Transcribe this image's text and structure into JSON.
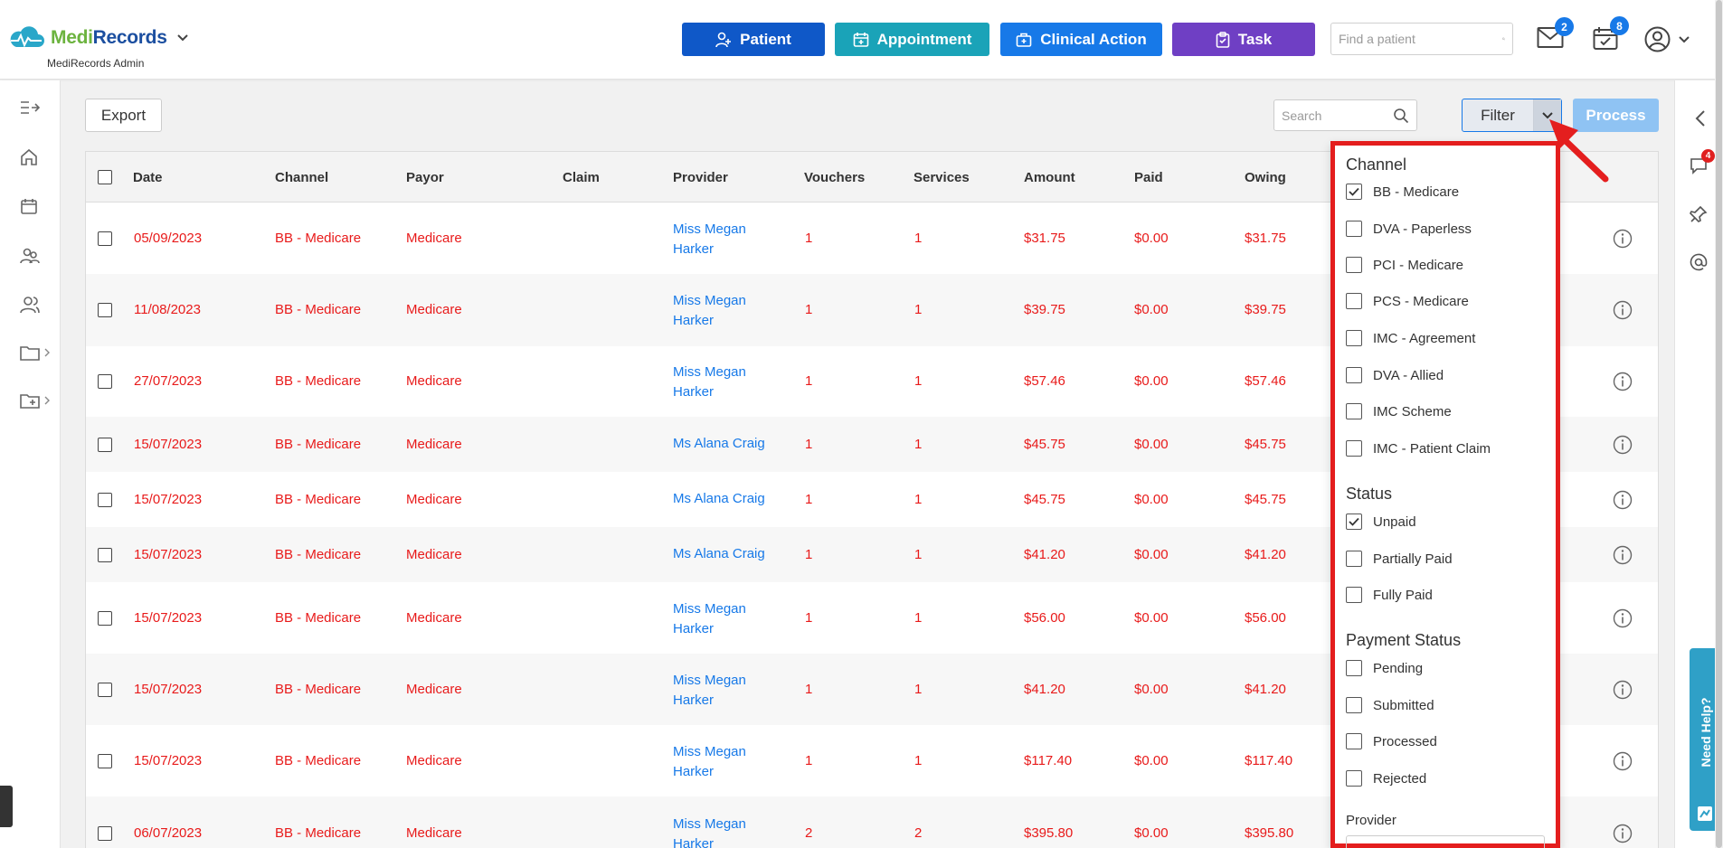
{
  "header": {
    "brand_medi": "Medi",
    "brand_records": "Records",
    "subtitle": "MediRecords Admin",
    "buttons": {
      "patient": "Patient",
      "appointment": "Appointment",
      "clinical_action": "Clinical Action",
      "task": "Task"
    },
    "find_patient_placeholder": "Find a patient",
    "mail_count": "2",
    "tasks_count": "8"
  },
  "toolbar": {
    "export_label": "Export",
    "search_placeholder": "Search",
    "filter_label": "Filter",
    "process_label": "Process"
  },
  "table": {
    "columns": [
      "Date",
      "Channel",
      "Payor",
      "Claim",
      "Provider",
      "Vouchers",
      "Services",
      "Amount",
      "Paid",
      "Owing"
    ],
    "rows": [
      {
        "date": "05/09/2023",
        "channel": "BB - Medicare",
        "payor": "Medicare",
        "claim": "",
        "provider": "Miss Megan Harker",
        "vouchers": "1",
        "services": "1",
        "amount": "$31.75",
        "paid": "$0.00",
        "owing": "$31.75"
      },
      {
        "date": "11/08/2023",
        "channel": "BB - Medicare",
        "payor": "Medicare",
        "claim": "",
        "provider": "Miss Megan Harker",
        "vouchers": "1",
        "services": "1",
        "amount": "$39.75",
        "paid": "$0.00",
        "owing": "$39.75"
      },
      {
        "date": "27/07/2023",
        "channel": "BB - Medicare",
        "payor": "Medicare",
        "claim": "",
        "provider": "Miss Megan Harker",
        "vouchers": "1",
        "services": "1",
        "amount": "$57.46",
        "paid": "$0.00",
        "owing": "$57.46"
      },
      {
        "date": "15/07/2023",
        "channel": "BB - Medicare",
        "payor": "Medicare",
        "claim": "",
        "provider": "Ms Alana Craig",
        "vouchers": "1",
        "services": "1",
        "amount": "$45.75",
        "paid": "$0.00",
        "owing": "$45.75"
      },
      {
        "date": "15/07/2023",
        "channel": "BB - Medicare",
        "payor": "Medicare",
        "claim": "",
        "provider": "Ms Alana Craig",
        "vouchers": "1",
        "services": "1",
        "amount": "$45.75",
        "paid": "$0.00",
        "owing": "$45.75"
      },
      {
        "date": "15/07/2023",
        "channel": "BB - Medicare",
        "payor": "Medicare",
        "claim": "",
        "provider": "Ms Alana Craig",
        "vouchers": "1",
        "services": "1",
        "amount": "$41.20",
        "paid": "$0.00",
        "owing": "$41.20"
      },
      {
        "date": "15/07/2023",
        "channel": "BB - Medicare",
        "payor": "Medicare",
        "claim": "",
        "provider": "Miss Megan Harker",
        "vouchers": "1",
        "services": "1",
        "amount": "$56.00",
        "paid": "$0.00",
        "owing": "$56.00"
      },
      {
        "date": "15/07/2023",
        "channel": "BB - Medicare",
        "payor": "Medicare",
        "claim": "",
        "provider": "Miss Megan Harker",
        "vouchers": "1",
        "services": "1",
        "amount": "$41.20",
        "paid": "$0.00",
        "owing": "$41.20"
      },
      {
        "date": "15/07/2023",
        "channel": "BB - Medicare",
        "payor": "Medicare",
        "claim": "",
        "provider": "Miss Megan Harker",
        "vouchers": "1",
        "services": "1",
        "amount": "$117.40",
        "paid": "$0.00",
        "owing": "$117.40"
      },
      {
        "date": "06/07/2023",
        "channel": "BB - Medicare",
        "payor": "Medicare",
        "claim": "",
        "provider": "Miss Megan Harker",
        "vouchers": "2",
        "services": "2",
        "amount": "$395.80",
        "paid": "$0.00",
        "owing": "$395.80"
      }
    ]
  },
  "filter_panel": {
    "channel_heading": "Channel",
    "channel_options": [
      {
        "label": "BB - Medicare",
        "checked": true
      },
      {
        "label": "DVA - Paperless",
        "checked": false
      },
      {
        "label": "PCI - Medicare",
        "checked": false
      },
      {
        "label": "PCS - Medicare",
        "checked": false
      },
      {
        "label": "IMC - Agreement",
        "checked": false
      },
      {
        "label": "DVA - Allied",
        "checked": false
      },
      {
        "label": "IMC Scheme",
        "checked": false
      },
      {
        "label": "IMC - Patient Claim",
        "checked": false
      }
    ],
    "status_heading": "Status",
    "status_options": [
      {
        "label": "Unpaid",
        "checked": true
      },
      {
        "label": "Partially Paid",
        "checked": false
      },
      {
        "label": "Fully Paid",
        "checked": false
      }
    ],
    "payment_heading": "Payment Status",
    "payment_options": [
      {
        "label": "Pending",
        "checked": false
      },
      {
        "label": "Submitted",
        "checked": false
      },
      {
        "label": "Processed",
        "checked": false
      },
      {
        "label": "Rejected",
        "checked": false
      }
    ],
    "provider_heading": "Provider"
  },
  "right_rail": {
    "notifications_count": "4",
    "need_help_label": "Need Help?"
  },
  "colors": {
    "primary_blue": "#0f58c8",
    "teal": "#1aa3b8",
    "clinical_blue": "#1779e8",
    "task_purple": "#6f3fc4",
    "owing_red": "#e81a1a",
    "highlight_red": "#e41e1e"
  },
  "icons": [
    "logo-cloud-icon",
    "chevron-down-icon",
    "add-user-icon",
    "calendar-icon",
    "medical-bag-icon",
    "clipboard-icon",
    "search-icon",
    "mail-icon",
    "calendar-check-icon",
    "user-circle-icon",
    "expand-menu-icon",
    "home-icon",
    "group-icon",
    "users-icon",
    "folder-icon",
    "folder-plus-icon",
    "chevron-left-icon",
    "chat-icon",
    "pin-icon",
    "at-icon",
    "info-icon",
    "red-arrow-icon"
  ]
}
